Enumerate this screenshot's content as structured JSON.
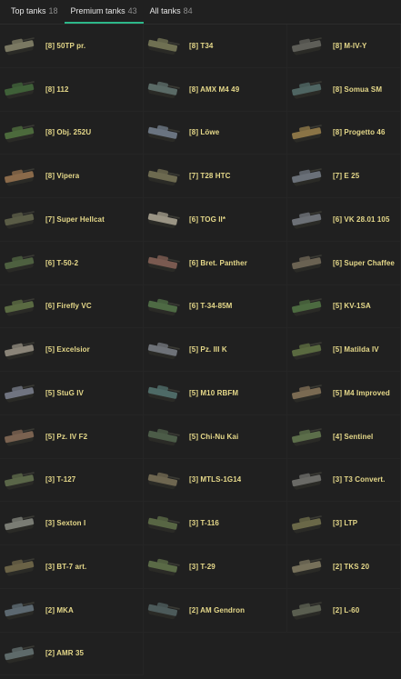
{
  "tabs": [
    {
      "label": "Top tanks",
      "count": "18",
      "active": false
    },
    {
      "label": "Premium tanks",
      "count": "43",
      "active": true
    },
    {
      "label": "All tanks",
      "count": "84",
      "active": false
    }
  ],
  "tanks": [
    {
      "label": "[8] 50TP pr.",
      "color": "#7a7862"
    },
    {
      "label": "[8] T34",
      "color": "#6f7052"
    },
    {
      "label": "[8] M-IV-Y",
      "color": "#5e5e58"
    },
    {
      "label": "[8] 112",
      "color": "#3f6038"
    },
    {
      "label": "[8] AMX M4 49",
      "color": "#5a6a66"
    },
    {
      "label": "[8] Somua SM",
      "color": "#4f6562"
    },
    {
      "label": "[8] Obj. 252U",
      "color": "#4c6a3c"
    },
    {
      "label": "[8] Löwe",
      "color": "#6a7480"
    },
    {
      "label": "[8] Progetto 46",
      "color": "#8a7446"
    },
    {
      "label": "[8] Vipera",
      "color": "#8a6a4a"
    },
    {
      "label": "[7] T28 HTC",
      "color": "#6d6a50"
    },
    {
      "label": "[7] E 25",
      "color": "#6a7078"
    },
    {
      "label": "[7] Super Hellcat",
      "color": "#5a5c46"
    },
    {
      "label": "[6] TOG II*",
      "color": "#9a9484"
    },
    {
      "label": "[6] VK 28.01 105",
      "color": "#6c7076"
    },
    {
      "label": "[6] T-50-2",
      "color": "#4e6040"
    },
    {
      "label": "[6] Bret. Panther",
      "color": "#7a5a50"
    },
    {
      "label": "[6] Super Chaffee",
      "color": "#6a6252"
    },
    {
      "label": "[6] Firefly VC",
      "color": "#5a6a42"
    },
    {
      "label": "[6] T-34-85M",
      "color": "#4e6a44"
    },
    {
      "label": "[5] KV-1SA",
      "color": "#4c6a40"
    },
    {
      "label": "[5] Excelsior",
      "color": "#8a8478"
    },
    {
      "label": "[5] Pz. III K",
      "color": "#6e7278"
    },
    {
      "label": "[5] Matilda IV",
      "color": "#5a6a40"
    },
    {
      "label": "[5] StuG IV",
      "color": "#707480"
    },
    {
      "label": "[5] M10 RBFM",
      "color": "#4e6a66"
    },
    {
      "label": "[5] M4 Improved",
      "color": "#7a6a52"
    },
    {
      "label": "[5] Pz. IV F2",
      "color": "#7a6250"
    },
    {
      "label": "[5] Chi-Nu Kai",
      "color": "#4c5c48"
    },
    {
      "label": "[4] Sentinel",
      "color": "#5c6e4a"
    },
    {
      "label": "[3] T-127",
      "color": "#5a6648"
    },
    {
      "label": "[3] MTLS-1G14",
      "color": "#6e6650"
    },
    {
      "label": "[3] T3 Convert.",
      "color": "#6a6a66"
    },
    {
      "label": "[3] Sexton I",
      "color": "#7a7c74"
    },
    {
      "label": "[3] T-116",
      "color": "#586644"
    },
    {
      "label": "[3] LTP",
      "color": "#6a6848"
    },
    {
      "label": "[3] BT-7 art.",
      "color": "#6a6246"
    },
    {
      "label": "[3] T-29",
      "color": "#5a6a46"
    },
    {
      "label": "[2] TKS 20",
      "color": "#76705a"
    },
    {
      "label": "[2] MKA",
      "color": "#5c6870"
    },
    {
      "label": "[2] AM Gendron",
      "color": "#4c5a5a"
    },
    {
      "label": "[2] L-60",
      "color": "#5a5e50"
    },
    {
      "label": "[2] AMR 35",
      "color": "#5e6a6a"
    }
  ]
}
